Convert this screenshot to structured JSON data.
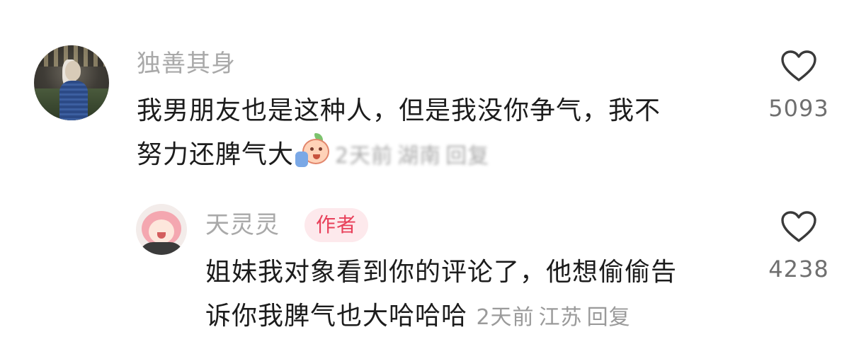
{
  "comments": [
    {
      "username": "独善其身",
      "text_line1": "我男朋友也是这种人，但是我没你争气，我不",
      "text_line2": "努力还脾气大",
      "sticker_icon": "crying-peach-emoji",
      "meta_time": "2天前",
      "meta_location": "湖南",
      "reply_label": "回复",
      "like_count": "5093"
    },
    {
      "username": "天灵灵",
      "author_badge": "作者",
      "text_line1": "姐妹我对象看到你的评论了，他想偷偷告",
      "text_line2": "诉你我脾气也大哈哈哈",
      "meta_time": "2天前",
      "meta_location": "江苏",
      "reply_label": "回复",
      "like_count": "4238"
    }
  ],
  "colors": {
    "username": "#a9a9a9",
    "body_text": "#1c1c1c",
    "meta_text": "#9a9a9a",
    "badge_bg": "#fde9ec",
    "badge_text": "#e8405a",
    "like_icon": "#3a3a3a"
  }
}
